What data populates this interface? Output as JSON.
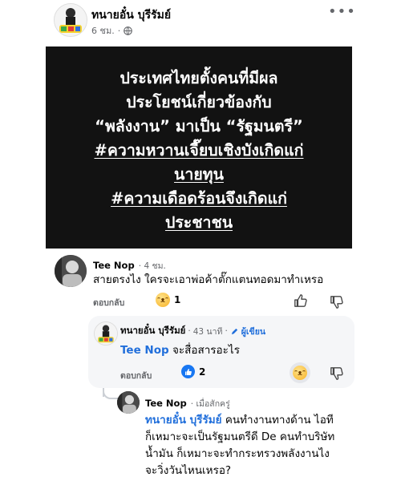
{
  "post": {
    "author": "ทนายอั๋น บุรีรัมย์",
    "time": "6 ชม.",
    "separator": "·",
    "audience_icon": "globe-icon",
    "more_icon": "ellipsis-icon",
    "image_lines": [
      "ประเทศไทยตั้งคนที่มีผล",
      "ประโยชน์เกี่ยวข้องกับ",
      "“พลังงาน” มาเป็น “รัฐมนตรี”",
      "#ความหวานเจี๊ยบเชิงบังเกิดแก่",
      "นายทุน",
      "#ความเดือดร้อนจึงเกิดแก่",
      "ประชาชน"
    ]
  },
  "comments": [
    {
      "name": "Tee Nop",
      "time": "4 ชม.",
      "text": "สายตรงไง ใครจะเอาพ่อค้าตั๊กแตนทอดมาทำเหรอ",
      "reply_label": "ตอบกลับ",
      "reaction": "haha",
      "reaction_count": "1"
    },
    {
      "name": "ทนายอั๋น บุรีรัมย์",
      "time": "43 นาที",
      "author_badge": "ผู้เขียน",
      "mention": "Tee Nop",
      "text": " จะสื่อสารอะไร",
      "reply_label": "ตอบกลับ",
      "reaction": "like",
      "reaction_count": "2"
    },
    {
      "name": "Tee Nop",
      "time": "เมื่อสักครู่",
      "mention": "ทนายอั๋น บุรีรัมย์",
      "lines": [
        " คนทำงานทางด้าน ไอที",
        "ก็เหมาะจะเป็นรัฐมนตรีดี De คนทำบริษัท",
        "น้ำมัน ก็เหมาะจะทำกระทรวงพลังงานไง",
        "จะวิ่งวันไหนเหรอ?"
      ]
    }
  ],
  "icons": {
    "like_outline": "thumbs-up-icon",
    "dislike_outline": "thumbs-down-icon",
    "pen": "pen-icon"
  }
}
